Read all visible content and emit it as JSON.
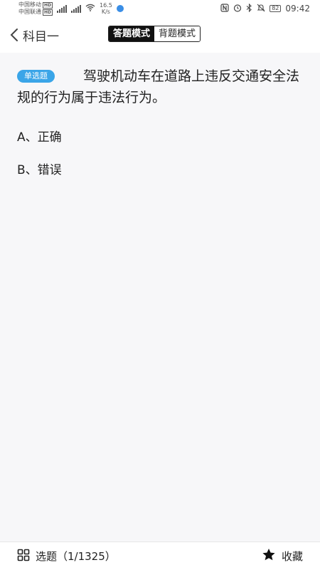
{
  "status_bar": {
    "carrier1": "中国移动",
    "carrier2": "中国联通",
    "hd": "HD",
    "net_speed_value": "16.5",
    "net_speed_unit": "K/s",
    "battery": "82",
    "time": "09:42"
  },
  "header": {
    "title": "科目一",
    "modes": [
      "答题模式",
      "背题模式"
    ],
    "active_mode": "答题模式"
  },
  "question": {
    "type": "单选题",
    "text": "驾驶机动车在道路上违反交通安全法规的行为属于违法行为。",
    "options": [
      "A、正确",
      "B、错误"
    ]
  },
  "bottom": {
    "select_label": "选题（1/1325）",
    "favorite_label": "收藏"
  }
}
